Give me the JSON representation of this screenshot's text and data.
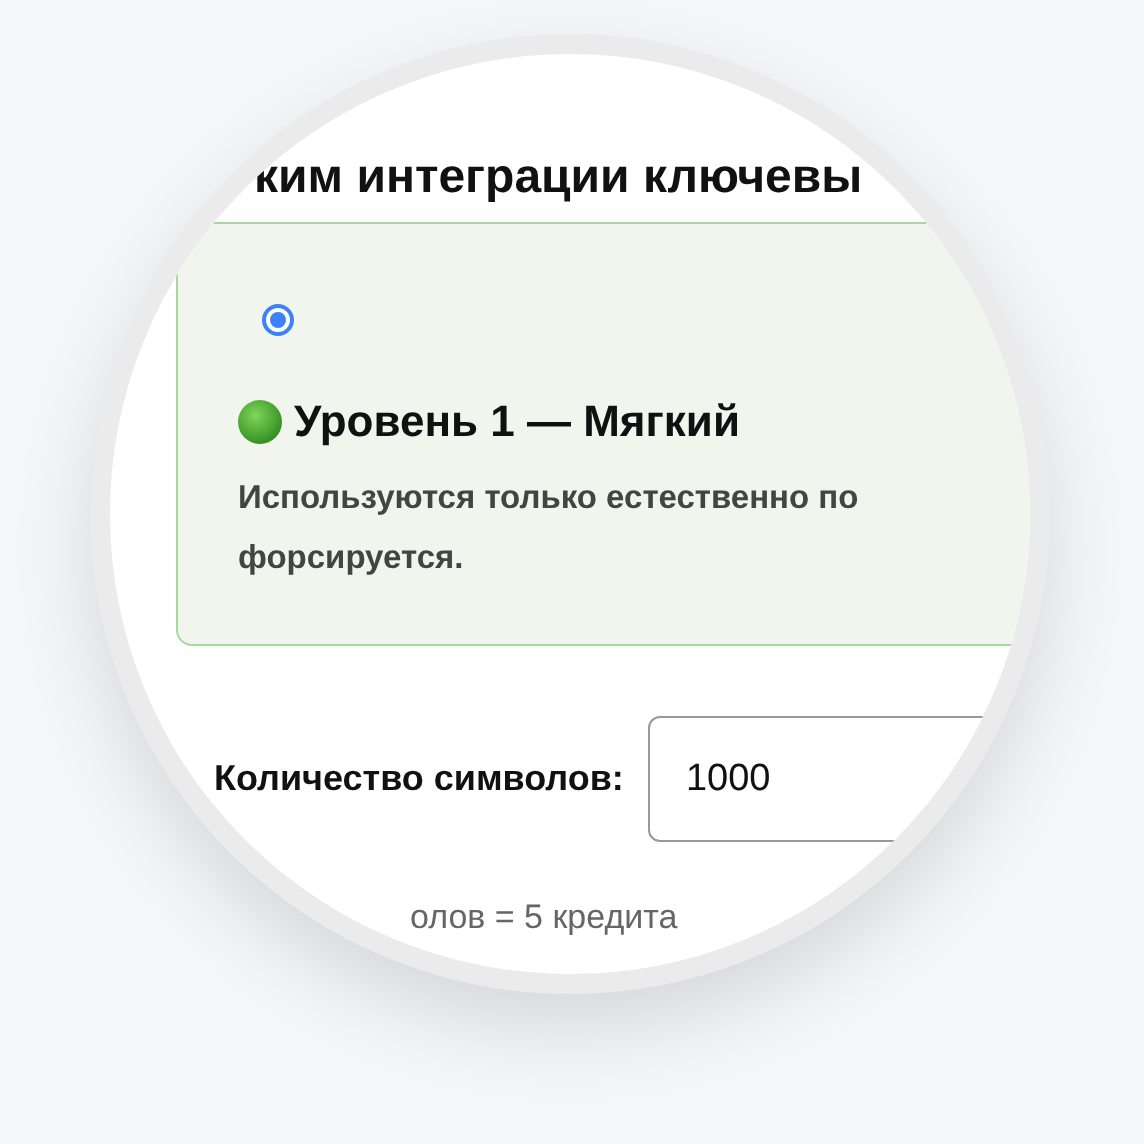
{
  "heading": "ким интеграции ключевы",
  "option": {
    "selected": true,
    "title": "Уровень 1 — Мягкий",
    "description_lines": [
      "Используются только естественно по",
      "форсируется."
    ]
  },
  "field": {
    "label": "Количество символов:",
    "value": "1000"
  },
  "hint": "олов = 5 кредита"
}
